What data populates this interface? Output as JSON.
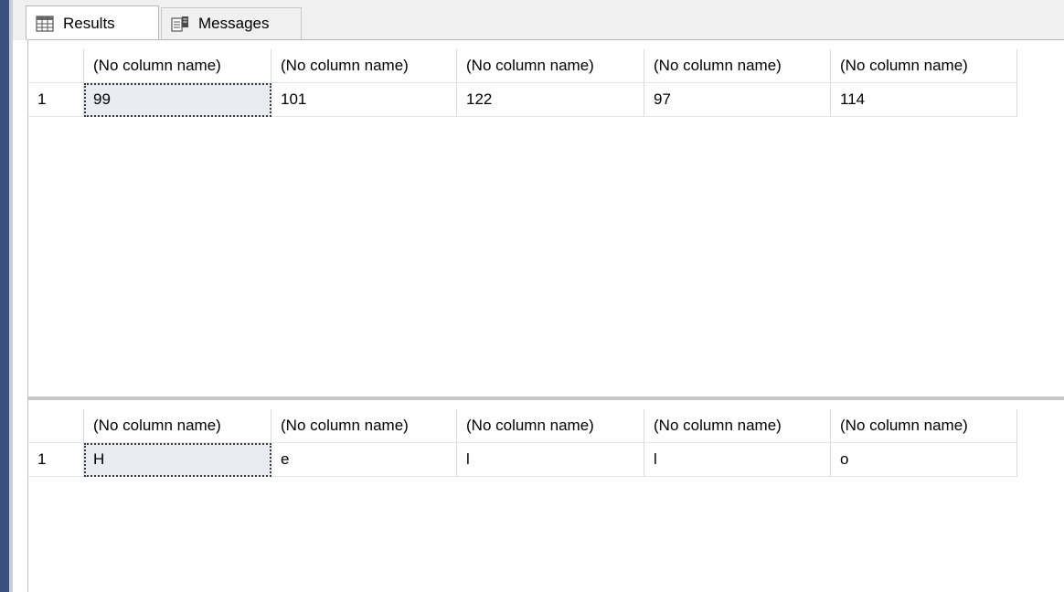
{
  "tabs": {
    "results_label": "Results",
    "messages_label": "Messages"
  },
  "grid1": {
    "headers": [
      "(No column name)",
      "(No column name)",
      "(No column name)",
      "(No column name)",
      "(No column name)"
    ],
    "rows": [
      {
        "row_number": "1",
        "cells": [
          "99",
          "101",
          "122",
          "97",
          "114"
        ]
      }
    ]
  },
  "grid2": {
    "headers": [
      "(No column name)",
      "(No column name)",
      "(No column name)",
      "(No column name)",
      "(No column name)"
    ],
    "rows": [
      {
        "row_number": "1",
        "cells": [
          "H",
          "e",
          "l",
          "l",
          "o"
        ]
      }
    ]
  },
  "icons": {
    "results_tab": "grid-icon",
    "messages_tab": "messages-icon"
  },
  "colors": {
    "selected_cell_bg": "#e9ecf0",
    "tabbar_bg": "#f0f0f0",
    "left_edge": "#3a5080"
  }
}
